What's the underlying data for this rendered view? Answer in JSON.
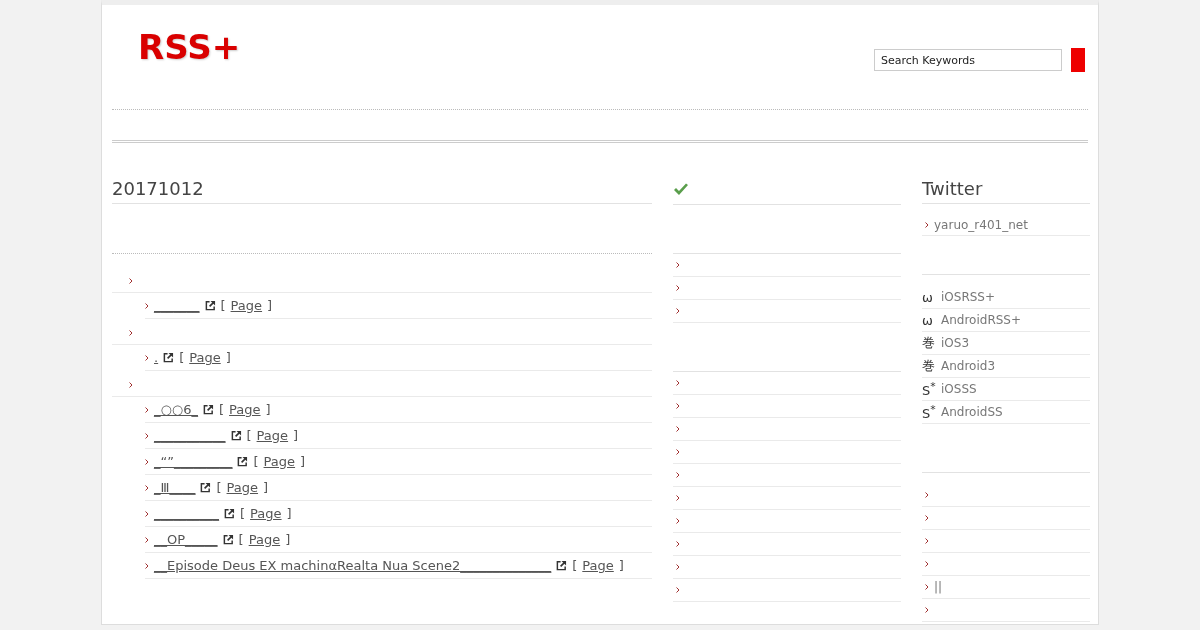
{
  "header": {
    "logo": "RSS+",
    "search": {
      "value": "Search Keywords"
    }
  },
  "main": {
    "date": "20171012",
    "categories": [
      {
        "children": [
          {
            "title": "_______",
            "open": "[",
            "page": "Page",
            "close": "]"
          }
        ]
      },
      {
        "children": [
          {
            "title": ".",
            "open": "[",
            "page": "Page",
            "close": "]"
          }
        ]
      },
      {
        "children": [
          {
            "title": "_○○6_",
            "open": "[",
            "page": "Page",
            "close": "]"
          },
          {
            "title": "___________",
            "open": "[",
            "page": "Page",
            "close": "]"
          },
          {
            "title": "_“”_________",
            "open": "[",
            "page": "Page",
            "close": "]"
          },
          {
            "title": "_Ⅲ____",
            "open": "[",
            "page": "Page",
            "close": "]"
          },
          {
            "title": "__________",
            "open": "[",
            "page": "Page",
            "close": "]"
          },
          {
            "title": "__OP_____",
            "open": "[",
            "page": "Page",
            "close": "]"
          },
          {
            "title": "__Episode Deus EX machinαRealta Nua Scene2______________",
            "open": "[",
            "page": "Page",
            "close": "]"
          }
        ]
      }
    ]
  },
  "middle": {
    "sections": [
      {
        "kind": "check",
        "rows": [
          {
            "kind": "bullet"
          },
          {
            "kind": "bullet"
          },
          {
            "kind": "bullet"
          }
        ]
      },
      {
        "kind": "blank",
        "rows": [
          {
            "kind": "bullet"
          },
          {
            "kind": "bullet"
          },
          {
            "kind": "bullet"
          },
          {
            "kind": "bullet"
          },
          {
            "kind": "bullet"
          },
          {
            "kind": "bullet"
          },
          {
            "kind": "bullet"
          },
          {
            "kind": "bullet"
          },
          {
            "kind": "bullet"
          },
          {
            "kind": "bullet"
          }
        ]
      }
    ]
  },
  "sidebar": {
    "title": "Twitter",
    "account": "yaruo_r401_net",
    "apps": [
      {
        "icon": "ω",
        "label": "iOSRSS+"
      },
      {
        "icon": "ω",
        "label": "AndroidRSS+"
      },
      {
        "icon": "巻",
        "label": "iOS3"
      },
      {
        "icon": "巻",
        "label": "Android3"
      },
      {
        "icon": "S$^{*}$",
        "label": "iOSSS"
      },
      {
        "icon": "S$^{*}$",
        "label": "AndroidSS"
      }
    ],
    "links": [
      {
        "kind": "bullet"
      },
      {
        "kind": "bullet"
      },
      {
        "kind": "bullet"
      },
      {
        "kind": "bullet"
      },
      {
        "kind": "text",
        "label": "||"
      },
      {
        "kind": "bullet"
      }
    ]
  }
}
